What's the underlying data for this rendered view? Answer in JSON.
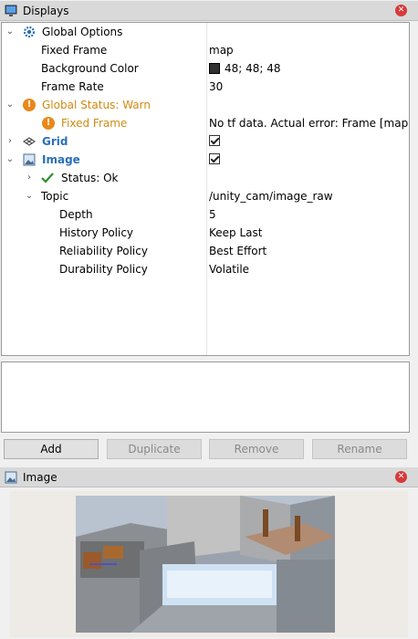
{
  "displays_panel": {
    "title": "Displays",
    "close_icon": "close-icon"
  },
  "tree": {
    "global_options": {
      "label": "Global Options",
      "icon": "gear-icon"
    },
    "fixed_frame": {
      "label": "Fixed Frame",
      "value": "map"
    },
    "background_color": {
      "label": "Background Color",
      "value": "48; 48; 48",
      "swatch": "#303030"
    },
    "frame_rate": {
      "label": "Frame Rate",
      "value": "30"
    },
    "global_status": {
      "label": "Global Status: Warn",
      "icon": "warning-icon",
      "color": "#d08a13"
    },
    "fixed_frame_warn": {
      "label": "Fixed Frame",
      "value": "No tf data.  Actual error: Frame [map] d..."
    },
    "grid": {
      "label": "Grid",
      "icon": "grid-icon",
      "checked": true
    },
    "image": {
      "label": "Image",
      "icon": "image-icon",
      "checked": true
    },
    "status_ok": {
      "label": "Status: Ok",
      "icon": "checkmark-icon"
    },
    "topic": {
      "label": "Topic",
      "value": "/unity_cam/image_raw"
    },
    "depth": {
      "label": "Depth",
      "value": "5"
    },
    "history_policy": {
      "label": "History Policy",
      "value": "Keep Last"
    },
    "reliability_policy": {
      "label": "Reliability Policy",
      "value": "Best Effort"
    },
    "durability_policy": {
      "label": "Durability Policy",
      "value": "Volatile"
    }
  },
  "buttons": {
    "add": "Add",
    "duplicate": "Duplicate",
    "remove": "Remove",
    "rename": "Rename"
  },
  "image_panel": {
    "title": "Image",
    "close_icon": "close-icon"
  },
  "colors": {
    "warn": "#d08a13",
    "link_blue": "#2a6fb8",
    "header_bg": "#d9d9d9",
    "close_red": "#d63a3a"
  }
}
